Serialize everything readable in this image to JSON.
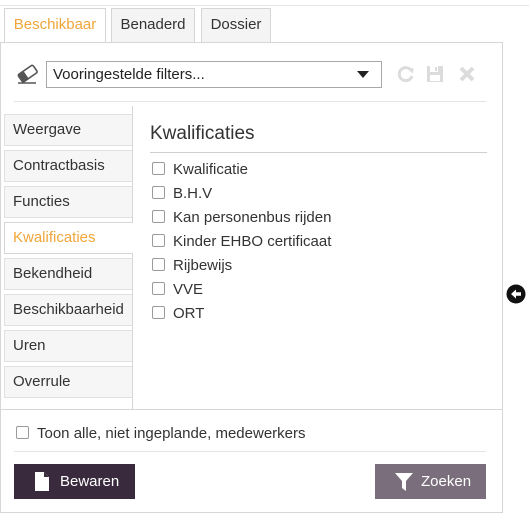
{
  "tabs": [
    {
      "label": "Beschikbaar",
      "active": true
    },
    {
      "label": "Benaderd",
      "active": false
    },
    {
      "label": "Dossier",
      "active": false
    }
  ],
  "filters": {
    "selected": "Vooringestelde filters...",
    "icons": [
      "eraser-icon",
      "refresh-icon",
      "save-icon",
      "close-icon"
    ]
  },
  "sidebar": {
    "items": [
      {
        "label": "Weergave"
      },
      {
        "label": "Contractbasis"
      },
      {
        "label": "Functies"
      },
      {
        "label": "Kwalificaties",
        "active": true
      },
      {
        "label": "Bekendheid"
      },
      {
        "label": "Beschikbaarheid"
      },
      {
        "label": "Uren"
      },
      {
        "label": "Overrule"
      }
    ]
  },
  "content": {
    "title": "Kwalificaties",
    "options": [
      {
        "label": "Kwalificatie",
        "checked": false
      },
      {
        "label": "B.H.V",
        "checked": false
      },
      {
        "label": "Kan personenbus rijden",
        "checked": false
      },
      {
        "label": "Kinder EHBO certificaat",
        "checked": false
      },
      {
        "label": "Rijbewijs",
        "checked": false
      },
      {
        "label": "VVE",
        "checked": false
      },
      {
        "label": "ORT",
        "checked": false
      }
    ]
  },
  "footer": {
    "show_all_label": "Toon alle, niet ingeplande, medewerkers",
    "show_all_checked": false,
    "save_label": "Bewaren",
    "search_label": "Zoeken"
  },
  "colors": {
    "accent": "#f0a63a",
    "save_button": "#3a2a3d",
    "search_button": "#7a6e7c"
  }
}
